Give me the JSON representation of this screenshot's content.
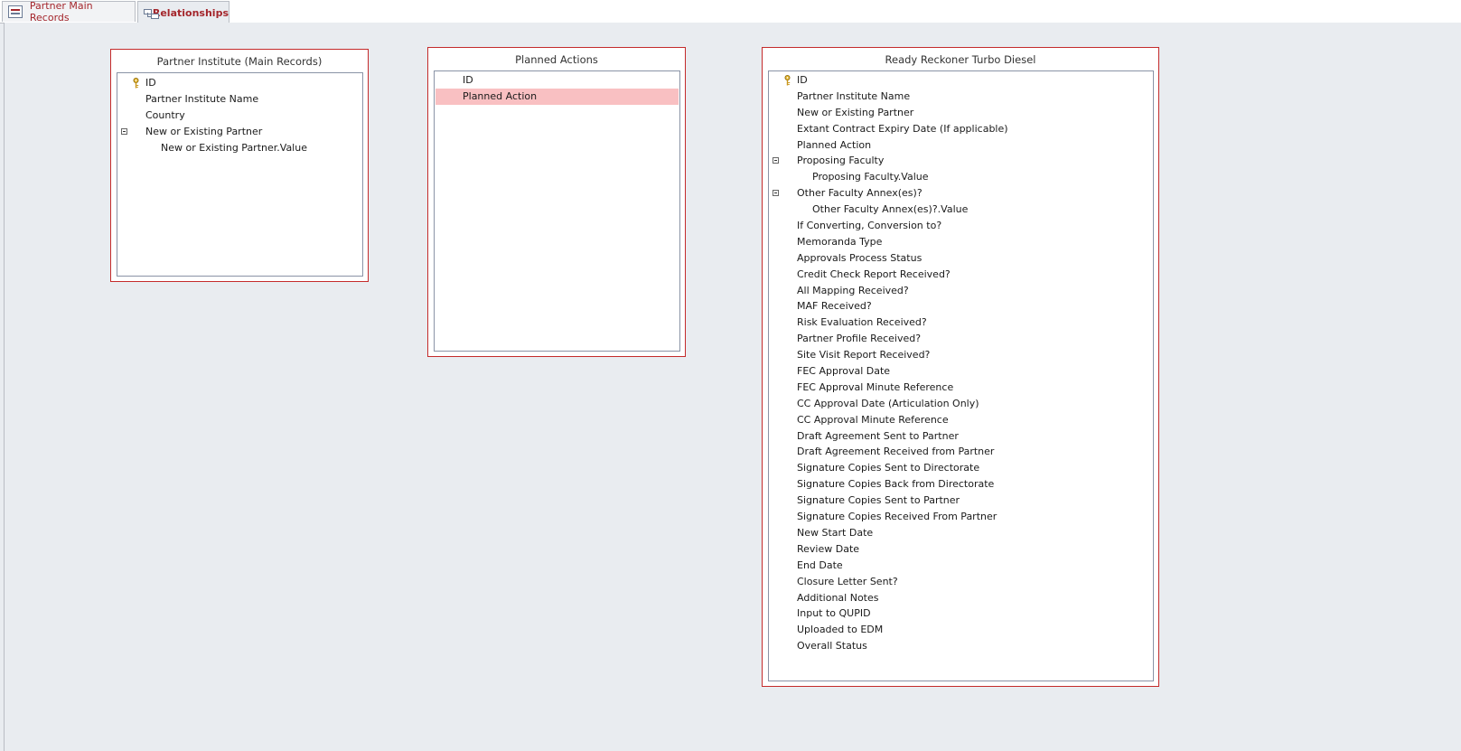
{
  "tabs": [
    {
      "label": "Partner Main Records",
      "active": false,
      "icon": "form-icon"
    },
    {
      "label": "Relationships",
      "active": true,
      "icon": "relationships-icon"
    }
  ],
  "tables": [
    {
      "title": "Partner Institute (Main Records)",
      "fields": [
        {
          "label": "ID",
          "key": true
        },
        {
          "label": "Partner Institute Name"
        },
        {
          "label": "Country"
        },
        {
          "label": "New or Existing Partner",
          "collapsible": true
        },
        {
          "label": "New or Existing Partner.Value",
          "sub": true
        }
      ]
    },
    {
      "title": "Planned Actions",
      "fields": [
        {
          "label": "ID"
        },
        {
          "label": "Planned Action",
          "selected": true
        }
      ]
    },
    {
      "title": "Ready Reckoner Turbo Diesel",
      "fields": [
        {
          "label": "ID",
          "key": true
        },
        {
          "label": "Partner Institute Name"
        },
        {
          "label": "New or Existing Partner"
        },
        {
          "label": "Extant Contract Expiry Date (If applicable)"
        },
        {
          "label": "Planned Action"
        },
        {
          "label": "Proposing Faculty",
          "collapsible": true
        },
        {
          "label": "Proposing Faculty.Value",
          "sub": true
        },
        {
          "label": "Other Faculty Annex(es)?",
          "collapsible": true
        },
        {
          "label": "Other Faculty Annex(es)?.Value",
          "sub": true
        },
        {
          "label": "If Converting, Conversion to?"
        },
        {
          "label": "Memoranda Type"
        },
        {
          "label": "Approvals Process Status"
        },
        {
          "label": "Credit Check Report Received?"
        },
        {
          "label": "All Mapping Received?"
        },
        {
          "label": "MAF Received?"
        },
        {
          "label": "Risk Evaluation Received?"
        },
        {
          "label": "Partner Profile Received?"
        },
        {
          "label": "Site Visit Report Received?"
        },
        {
          "label": "FEC Approval Date"
        },
        {
          "label": "FEC Approval Minute Reference"
        },
        {
          "label": "CC Approval Date (Articulation Only)"
        },
        {
          "label": "CC Approval Minute Reference"
        },
        {
          "label": "Draft Agreement Sent to Partner"
        },
        {
          "label": "Draft Agreement Received from Partner"
        },
        {
          "label": "Signature Copies Sent to Directorate"
        },
        {
          "label": "Signature Copies Back from Directorate"
        },
        {
          "label": "Signature Copies Sent to Partner"
        },
        {
          "label": "Signature Copies Received From Partner"
        },
        {
          "label": "New Start Date"
        },
        {
          "label": "Review Date"
        },
        {
          "label": "End Date"
        },
        {
          "label": "Closure Letter Sent?"
        },
        {
          "label": "Additional Notes"
        },
        {
          "label": "Input to QUPID"
        },
        {
          "label": "Uploaded to EDM"
        },
        {
          "label": "Overall Status"
        }
      ]
    }
  ],
  "colors": {
    "accent": "#a4262c",
    "window_border": "#c42b2b",
    "selection": "#f9c0c2",
    "canvas": "#e9ecf0"
  }
}
